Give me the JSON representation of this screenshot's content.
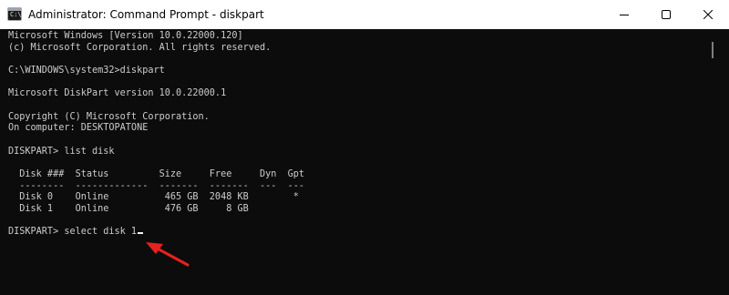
{
  "window": {
    "title": "Administrator: Command Prompt - diskpart",
    "app_icon_glyph": "C:\\",
    "controls": {
      "minimize_icon": "minimize-icon",
      "maximize_icon": "maximize-icon",
      "close_icon": "close-icon"
    }
  },
  "terminal": {
    "lines": [
      "Microsoft Windows [Version 10.0.22000.120]",
      "(c) Microsoft Corporation. All rights reserved.",
      "",
      "C:\\WINDOWS\\system32>diskpart",
      "",
      "Microsoft DiskPart version 10.0.22000.1",
      "",
      "Copyright (C) Microsoft Corporation.",
      "On computer: DESKTOPATONE",
      "",
      "DISKPART> list disk",
      "",
      "  Disk ###  Status         Size     Free     Dyn  Gpt",
      "  --------  -------------  -------  -------  ---  ---",
      "  Disk 0    Online          465 GB  2048 KB        *",
      "  Disk 1    Online          476 GB     8 GB",
      "",
      "DISKPART> select disk 1"
    ]
  },
  "colors": {
    "titlebar_bg": "#ffffff",
    "terminal_bg": "#0c0c0c",
    "terminal_fg": "#cccccc",
    "annotation_arrow": "#e8211c"
  },
  "annotation": {
    "icon": "red-arrow-icon"
  }
}
